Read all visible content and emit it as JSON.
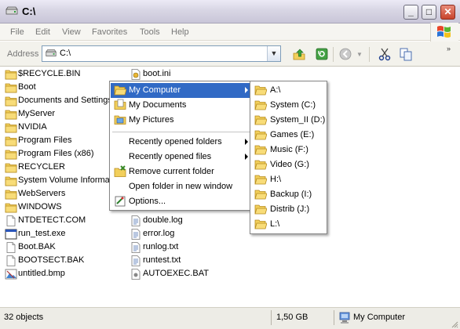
{
  "window": {
    "title": "C:\\"
  },
  "titlebar_buttons": {
    "minimize": "_",
    "maximize": "□",
    "close": "✕"
  },
  "menubar": [
    "File",
    "Edit",
    "View",
    "Favorites",
    "Tools",
    "Help"
  ],
  "address": {
    "label": "Address",
    "value": "C:\\"
  },
  "files_col1": [
    {
      "name": "$RECYCLE.BIN",
      "icon": "folder-icon"
    },
    {
      "name": "Boot",
      "icon": "folder-icon"
    },
    {
      "name": "Documents and Settings",
      "icon": "folder-icon"
    },
    {
      "name": "MyServer",
      "icon": "folder-icon"
    },
    {
      "name": "NVIDIA",
      "icon": "folder-icon"
    },
    {
      "name": "Program Files",
      "icon": "folder-icon"
    },
    {
      "name": "Program Files (x86)",
      "icon": "folder-icon"
    },
    {
      "name": "RECYCLER",
      "icon": "folder-icon"
    },
    {
      "name": "System Volume Informati",
      "icon": "folder-icon"
    },
    {
      "name": "WebServers",
      "icon": "folder-icon"
    },
    {
      "name": "WINDOWS",
      "icon": "folder-icon"
    },
    {
      "name": "NTDETECT.COM",
      "icon": "file-icon"
    },
    {
      "name": "run_test.exe",
      "icon": "exe-icon"
    },
    {
      "name": "Boot.BAK",
      "icon": "file-icon"
    },
    {
      "name": "BOOTSECT.BAK",
      "icon": "file-icon"
    },
    {
      "name": "untitled.bmp",
      "icon": "bitmap-icon"
    }
  ],
  "files_col2_top": [
    {
      "name": "boot.ini",
      "icon": "config-icon"
    }
  ],
  "files_col2_bottom": [
    {
      "name": "double.log",
      "icon": "text-file-icon"
    },
    {
      "name": "error.log",
      "icon": "text-file-icon"
    },
    {
      "name": "runlog.txt",
      "icon": "text-file-icon"
    },
    {
      "name": "runtest.txt",
      "icon": "text-file-icon"
    },
    {
      "name": "AUTOEXEC.BAT",
      "icon": "batch-file-icon"
    }
  ],
  "context_menu": {
    "group1": [
      {
        "label": "My Computer",
        "icon": "folder-open-icon",
        "submenu": true,
        "highlighted": true
      },
      {
        "label": "My Documents",
        "icon": "documents-icon"
      },
      {
        "label": "My Pictures",
        "icon": "pictures-icon"
      }
    ],
    "group2": [
      {
        "label": "Recently opened folders",
        "submenu": true
      },
      {
        "label": "Recently opened files",
        "submenu": true
      },
      {
        "label": "Remove current folder",
        "icon": "remove-folder-icon"
      },
      {
        "label": "Open folder in new window"
      },
      {
        "label": "Options...",
        "icon": "options-icon"
      }
    ]
  },
  "submenu": [
    "A:\\",
    "System (C:)",
    "System_II (D:)",
    "Games (E:)",
    "Music (F:)",
    "Video (G:)",
    "H:\\",
    "Backup (I:)",
    "Distrib (J:)",
    "L:\\"
  ],
  "status": {
    "objects": "32 objects",
    "size": "1,50 GB",
    "location": "My Computer"
  },
  "colors": {
    "highlight": "#316ac5",
    "folder": "#f2cf5b",
    "titlebar": "#d8d6e4"
  }
}
